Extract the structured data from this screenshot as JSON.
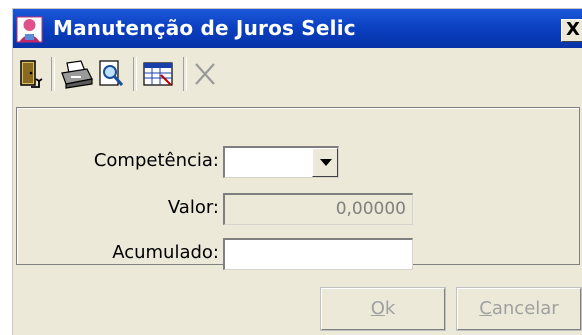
{
  "window": {
    "title": "Manutenção de Juros Selic",
    "close_glyph": "X",
    "title_icon": "person-icon"
  },
  "toolbar": {
    "items": [
      {
        "name": "exit-icon"
      },
      {
        "name": "printer-icon"
      },
      {
        "name": "print-preview-icon"
      },
      {
        "name": "table-grid-icon"
      },
      {
        "name": "delete-icon"
      }
    ]
  },
  "form": {
    "competencia_label": "Competência:",
    "competencia_value": "",
    "valor_label": "Valor:",
    "valor_value": "0,00000",
    "acumulado_label": "Acumulado:",
    "acumulado_value": ""
  },
  "buttons": {
    "ok_mnemonic": "O",
    "ok_rest": "k",
    "cancel_mnemonic": "C",
    "cancel_rest": "ancelar"
  },
  "colors": {
    "titlebar": "#0a3fbf",
    "face": "#ece9d8"
  }
}
